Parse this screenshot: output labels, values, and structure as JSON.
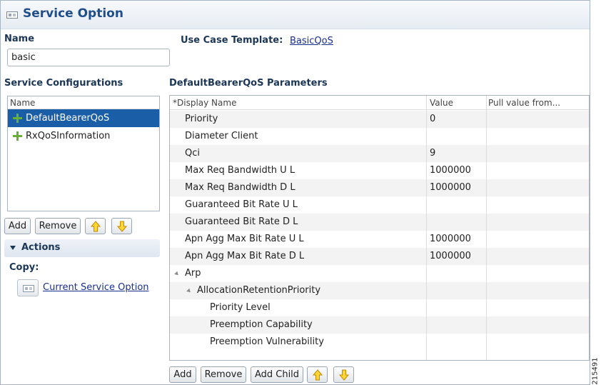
{
  "title": "Service Option",
  "name_section": {
    "label": "Name",
    "value": "basic"
  },
  "use_case": {
    "label": "Use Case Template:",
    "link": "BasicQoS"
  },
  "service_configurations": {
    "label": "Service Configurations",
    "column_header": "Name",
    "items": [
      {
        "label": "DefaultBearerQoS",
        "selected": true
      },
      {
        "label": "RxQoSInformation",
        "selected": false
      }
    ],
    "buttons": {
      "add": "Add",
      "remove": "Remove"
    }
  },
  "actions": {
    "title": "Actions",
    "copy_label": "Copy:",
    "copy_link": "Current Service Option"
  },
  "parameters": {
    "label": "DefaultBearerQoS Parameters",
    "columns": [
      "*Display Name",
      "Value",
      "Pull value from..."
    ],
    "rows": [
      {
        "name": "Priority",
        "value": "0",
        "indent": 0,
        "expander": false
      },
      {
        "name": "Diameter Client",
        "value": "",
        "indent": 0,
        "expander": false
      },
      {
        "name": "Qci",
        "value": "9",
        "indent": 0,
        "expander": false
      },
      {
        "name": "Max Req Bandwidth U L",
        "value": "1000000",
        "indent": 0,
        "expander": false
      },
      {
        "name": "Max Req Bandwidth D L",
        "value": "1000000",
        "indent": 0,
        "expander": false
      },
      {
        "name": "Guaranteed Bit Rate U L",
        "value": "",
        "indent": 0,
        "expander": false
      },
      {
        "name": "Guaranteed Bit Rate D L",
        "value": "",
        "indent": 0,
        "expander": false
      },
      {
        "name": "Apn Agg Max Bit Rate U L",
        "value": "1000000",
        "indent": 0,
        "expander": false
      },
      {
        "name": "Apn Agg Max Bit Rate D L",
        "value": "1000000",
        "indent": 0,
        "expander": false
      },
      {
        "name": "Arp",
        "value": "",
        "indent": 0,
        "expander": true
      },
      {
        "name": "AllocationRetentionPriority",
        "value": "",
        "indent": 1,
        "expander": true
      },
      {
        "name": "Priority Level",
        "value": "",
        "indent": 2,
        "expander": false
      },
      {
        "name": "Preemption Capability",
        "value": "",
        "indent": 2,
        "expander": false
      },
      {
        "name": "Preemption Vulnerability",
        "value": "",
        "indent": 2,
        "expander": false
      }
    ],
    "buttons": {
      "add": "Add",
      "remove": "Remove",
      "add_child": "Add Child"
    }
  },
  "figure_id": "215491",
  "colors": {
    "title": "#1f4e8c",
    "selection": "#1a5ea8",
    "plus_icon": "#6aae3a",
    "arrow_icon": "#f0b400"
  }
}
